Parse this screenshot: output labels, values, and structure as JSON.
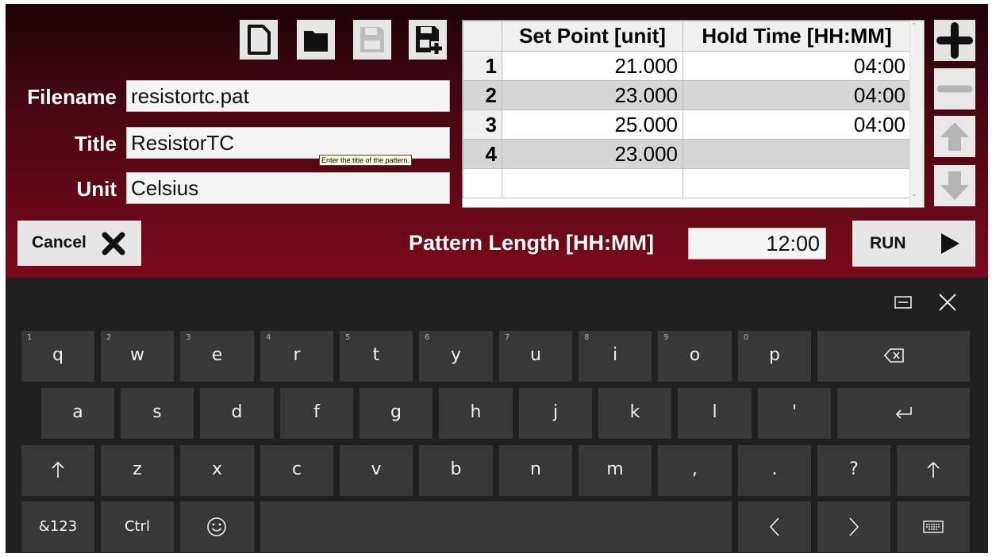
{
  "form": {
    "filename_label": "Filename",
    "filename_value": "resistortc.pat",
    "title_label": "Title",
    "title_value": "ResistorTC",
    "unit_label": "Unit",
    "unit_value": "Celsius",
    "title_tooltip": "Enter the title of the pattern."
  },
  "toolbar": {
    "new_icon": "new-file-icon",
    "open_icon": "open-folder-icon",
    "save_icon": "save-icon",
    "save_as_icon": "save-as-icon"
  },
  "grid": {
    "columns": [
      "Set Point [unit]",
      "Hold Time [HH:MM]"
    ],
    "rows": [
      {
        "num": "1",
        "set_point": "21.000",
        "hold_time": "04:00"
      },
      {
        "num": "2",
        "set_point": "23.000",
        "hold_time": "04:00"
      },
      {
        "num": "3",
        "set_point": "25.000",
        "hold_time": "04:00"
      },
      {
        "num": "4",
        "set_point": "23.000",
        "hold_time": ""
      },
      {
        "num": "",
        "set_point": "",
        "hold_time": ""
      }
    ]
  },
  "side_buttons": [
    "add-row-icon",
    "remove-row-icon",
    "move-up-icon",
    "move-down-icon"
  ],
  "footer": {
    "cancel_label": "Cancel",
    "pattern_length_label": "Pattern Length [HH:MM]",
    "pattern_length_value": "12:00",
    "run_label": "RUN"
  },
  "keyboard": {
    "row1": [
      {
        "k": "q",
        "n": "1"
      },
      {
        "k": "w",
        "n": "2"
      },
      {
        "k": "e",
        "n": "3"
      },
      {
        "k": "r",
        "n": "4"
      },
      {
        "k": "t",
        "n": "5"
      },
      {
        "k": "y",
        "n": "6"
      },
      {
        "k": "u",
        "n": "7"
      },
      {
        "k": "i",
        "n": "8"
      },
      {
        "k": "o",
        "n": "9"
      },
      {
        "k": "p",
        "n": "0"
      }
    ],
    "row2": [
      "a",
      "s",
      "d",
      "f",
      "g",
      "h",
      "j",
      "k",
      "l",
      "'"
    ],
    "row3": [
      "z",
      "x",
      "c",
      "v",
      "b",
      "n",
      "m",
      ",",
      ".",
      "?"
    ],
    "symbols_label": "&123",
    "ctrl_label": "Ctrl"
  },
  "colors": {
    "header_gradient_top": "#1a0407",
    "header_gradient_bottom": "#7a0a1b",
    "keyboard_bg": "#202020",
    "key_bg": "#383838"
  }
}
